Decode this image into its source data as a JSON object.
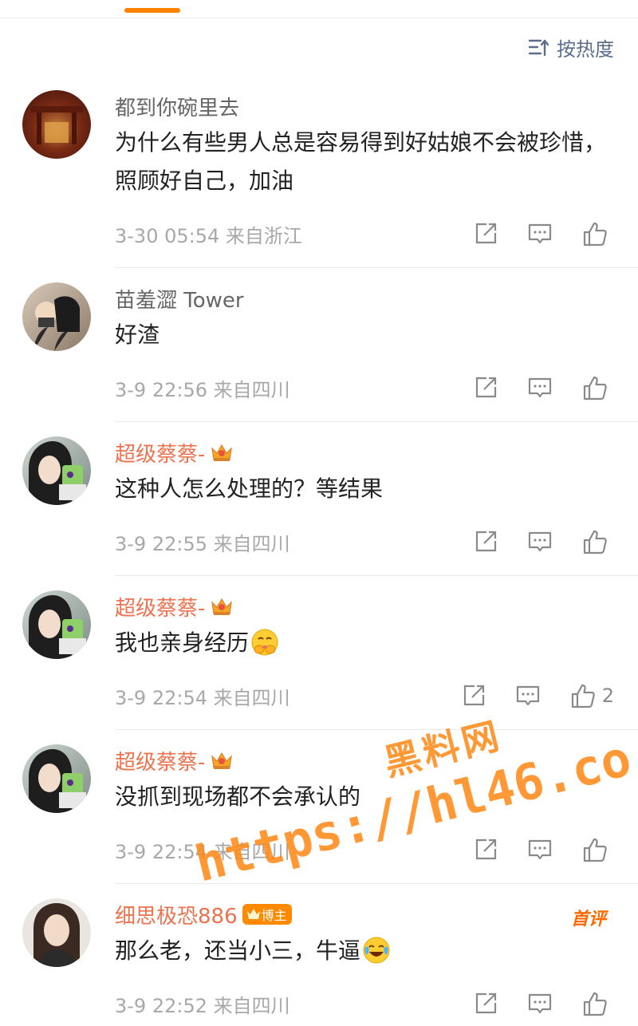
{
  "sort": {
    "label": "按热度"
  },
  "comments": [
    {
      "name": "都到你碗里去",
      "text": "为什么有些男人总是容易得到好姑娘不会被珍惜，照顾好自己，加油",
      "meta": "3-30 05:54 来自浙江",
      "likes": ""
    },
    {
      "name": "苗羞�romanTower",
      "text": "好渣",
      "meta": "3-9 22:56 来自四川",
      "likes": ""
    },
    {
      "name": "超级蔡蔡-",
      "text": "这种人怎么处理的？等结果",
      "meta": "3-9 22:55 来自四川",
      "likes": ""
    },
    {
      "name": "超级蔡蔡-",
      "text": "我也亲身经历",
      "meta": "3-9 22:54 来自四川",
      "likes": "2"
    },
    {
      "name": "超级蔡蔡-",
      "text": "没抓到现场都不会承认的",
      "meta": "3-9 22:54 来自四川",
      "likes": ""
    },
    {
      "name": "细思极恐886",
      "badge": "博主",
      "first_tag": "首评",
      "text": "那么老，还当小三，牛逼",
      "meta": "3-9 22:52 来自四川",
      "likes": ""
    }
  ],
  "watermark": {
    "line1": "黑料网",
    "line2": "https://hl46.co"
  }
}
